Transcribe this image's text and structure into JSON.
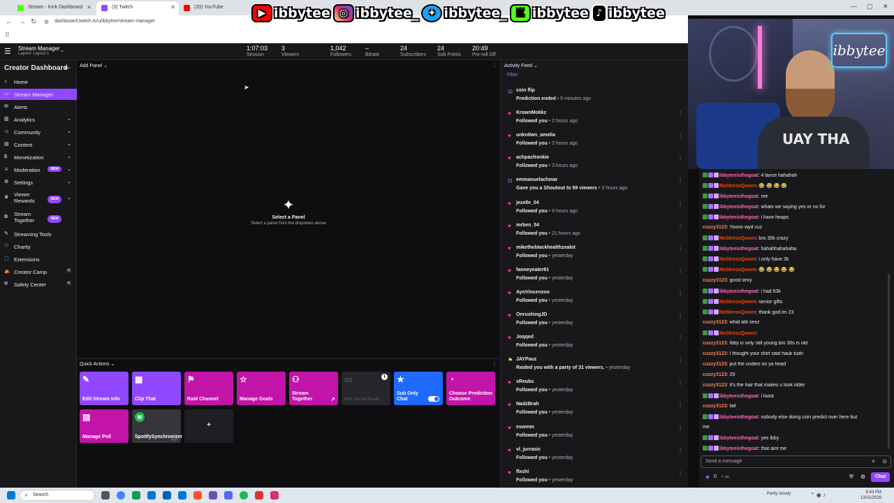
{
  "browser": {
    "tabs": [
      {
        "label": "Stream - Kick Dashboard",
        "color": "#53fc18"
      },
      {
        "label": "(3) Twitch",
        "color": "#9147ff"
      },
      {
        "label": "(20) YouTube",
        "color": "#ff0000"
      }
    ],
    "url": "dashboard.twitch.tv/u/ibbytee/stream-manager",
    "social": [
      {
        "icon": "youtube-icon",
        "color": "#ff0000",
        "handle": "ibbytee"
      },
      {
        "icon": "instagram-icon",
        "color": "#d62976",
        "handle": "ibbytee_"
      },
      {
        "icon": "twitter-icon",
        "color": "#1da1f2",
        "handle": "ibbytee_"
      },
      {
        "icon": "kick-icon",
        "color": "#53fc18",
        "handle": "ibbytee"
      },
      {
        "icon": "tiktok-icon",
        "color": "#000000",
        "handle": "ibbytee"
      }
    ]
  },
  "header": {
    "title": "Stream Manager",
    "layout": "Layout: Layout 1",
    "stats": [
      {
        "value": "1:07:03",
        "label": "Session"
      },
      {
        "value": "3",
        "label": "Viewers"
      },
      {
        "value": "1,042",
        "label": "Followers"
      },
      {
        "value": "–",
        "label": "Bitrate"
      },
      {
        "value": "24",
        "label": "Subscribers"
      },
      {
        "value": "24",
        "label": "Sub Points"
      },
      {
        "value": "20:49",
        "label": "Pre-roll Off"
      }
    ]
  },
  "sidebar": {
    "title": "Creator Dashboard",
    "items": [
      {
        "label": "Home"
      },
      {
        "label": "Stream Manager"
      },
      {
        "label": "Alerts"
      },
      {
        "label": "Analytics"
      },
      {
        "label": "Community"
      },
      {
        "label": "Content"
      },
      {
        "label": "Monetization"
      },
      {
        "label": "Moderation",
        "badge": "NEW"
      },
      {
        "label": "Settings"
      },
      {
        "label": "Viewer Rewards",
        "badge": "NEW"
      },
      {
        "label": "Stream Together",
        "badge": "NEW"
      },
      {
        "label": "Streaming Tools"
      },
      {
        "label": "Charity"
      },
      {
        "label": "Extensions"
      },
      {
        "label": "Creator Camp"
      },
      {
        "label": "Safety Center"
      }
    ]
  },
  "main": {
    "add_panel": "Add Panel",
    "select_title": "Select a Panel",
    "select_sub": "Select a panel from the dropdown above",
    "quick_actions_title": "Quick Actions",
    "quick_actions": [
      {
        "label": "Edit Stream Info",
        "color": "#9147ff"
      },
      {
        "label": "Clip That",
        "color": "#9147ff"
      },
      {
        "label": "Raid Channel",
        "color": "#c214a8"
      },
      {
        "label": "Manage Goals",
        "color": "#c214a8"
      },
      {
        "label": "Stream Together",
        "color": "#c214a8"
      },
      {
        "label": "Run 1m Ad Break",
        "color": "#26262c"
      },
      {
        "label": "Sub Only Chat",
        "color": "#1f69ff"
      },
      {
        "label": "Choose Prediction Outcome",
        "color": "#c214a8"
      },
      {
        "label": "Manage Poll",
        "color": "#c214a8"
      },
      {
        "label": "SpotifySynchronizer",
        "color": "#35353b"
      }
    ],
    "add_plus": "+"
  },
  "feed": {
    "title": "Activity Feed",
    "filter": "Filter",
    "entries": [
      {
        "name": "coin flip",
        "action": "Prediction ended",
        "time": "5 minutes ago",
        "icon": "prediction-icon"
      },
      {
        "name": "KrownMokkz",
        "action": "Followed you",
        "time": "2 hours ago",
        "icon": "heart-icon"
      },
      {
        "name": "unkn0wn_amelia",
        "action": "Followed you",
        "time": "2 hours ago",
        "icon": "heart-icon"
      },
      {
        "name": "achpacfrankie",
        "action": "Followed you",
        "time": "3 hours ago",
        "icon": "heart-icon"
      },
      {
        "name": "emmanuelachmar",
        "action": "Gave you a Shoutout to 59 viewers",
        "time": "3 hours ago",
        "icon": "shoutout-icon"
      },
      {
        "name": "jezelle_04",
        "action": "Followed you",
        "time": "6 hours ago",
        "icon": "heart-icon"
      },
      {
        "name": "mrben_54",
        "action": "Followed you",
        "time": "21 hours ago",
        "icon": "heart-icon"
      },
      {
        "name": "mikethebIackhealthzealot",
        "action": "Followed you",
        "time": "yesterday",
        "icon": "heart-icon"
      },
      {
        "name": "fanneyeater81",
        "action": "Followed you",
        "time": "yesterday",
        "icon": "heart-icon"
      },
      {
        "name": "AyoVincenzoo",
        "action": "Followed you",
        "time": "yesterday",
        "icon": "heart-icon"
      },
      {
        "name": "OnrushingJD",
        "action": "Followed you",
        "time": "yesterday",
        "icon": "heart-icon"
      },
      {
        "name": "Joqqed",
        "action": "Followed you",
        "time": "yesterday",
        "icon": "heart-icon"
      },
      {
        "name": "JAYPauz",
        "action": "Raided you with a party of 31 viewers.",
        "time": "yesterday",
        "icon": "raid-icon"
      },
      {
        "name": "xReubs",
        "action": "Followed you",
        "time": "yesterday",
        "icon": "heart-icon"
      },
      {
        "name": "NadzBrah",
        "action": "Followed you",
        "time": "yesterday",
        "icon": "heart-icon"
      },
      {
        "name": "eswmm",
        "action": "Followed you",
        "time": "yesterday",
        "icon": "heart-icon"
      },
      {
        "name": "vl_jurrasic",
        "action": "Followed you",
        "time": "yesterday",
        "icon": "heart-icon"
      },
      {
        "name": "flxshi",
        "action": "Followed you",
        "time": "yesterday",
        "icon": "heart-icon"
      }
    ]
  },
  "cam": {
    "overlay": "ibbytee"
  },
  "chat": {
    "messages": [
      {
        "user": "ibbyteeisthegoat",
        "color": "#ff69b4",
        "text": ": 4 lance hahahah"
      },
      {
        "user": "NoStressQueen",
        "color": "#ff4500",
        "text": ": 😂 😂 😂 😂"
      },
      {
        "user": "ibbyteeisthegoat",
        "color": "#ff69b4",
        "text": ": me"
      },
      {
        "user": "ibbyteeisthegoat",
        "color": "#ff69b4",
        "text": ": whats we saying yes or no for"
      },
      {
        "user": "ibbyteeisthegoat",
        "color": "#ff69b4",
        "text": ": i have heaps"
      },
      {
        "user": "cuzzy3123",
        "color": "#ff7f50",
        "text": ": Yoooo wyd cuz"
      },
      {
        "user": "NoStressQueen",
        "color": "#ff4500",
        "text": ": bro 35k crazy"
      },
      {
        "user": "ibbyteeisthegoat",
        "color": "#ff69b4",
        "text": ": hahahhahahaha"
      },
      {
        "user": "NoStressQueen",
        "color": "#ff4500",
        "text": ": i only have 2k"
      },
      {
        "user": "NoStressQueen",
        "color": "#ff4500",
        "text": ": 😂 😂 😂 😂 😂"
      },
      {
        "user": "cuzzy3123",
        "color": "#ff7f50",
        "text": ": good sexy"
      },
      {
        "user": "ibbyteeisthegoat",
        "color": "#ff69b4",
        "text": ": i had 63k"
      },
      {
        "user": "NoStressQueen",
        "color": "#ff4500",
        "text": ": senior gifts"
      },
      {
        "user": "NoStressQueen",
        "color": "#ff4500",
        "text": ": thank god im 23"
      },
      {
        "user": "cuzzy3123",
        "color": "#ff7f50",
        "text": ": what abt sexz"
      },
      {
        "user": "NoStressQueen",
        "color": "#ff4500",
        "text": ":"
      },
      {
        "user": "cuzzy3123",
        "color": "#ff7f50",
        "text": ": Ibby is only still young bro 30s is old"
      },
      {
        "user": "cuzzy3123",
        "color": "#ff7f50",
        "text": ": I thought your shirt said hauk tuah"
      },
      {
        "user": "cuzzy3123",
        "color": "#ff7f50",
        "text": ": put the undies on ya head"
      },
      {
        "user": "cuzzy3123",
        "color": "#ff7f50",
        "text": ": 29"
      },
      {
        "user": "cuzzy3123",
        "color": "#ff7f50",
        "text": ": it's the hair that makes u look older"
      },
      {
        "user": "ibbyteeisthegoat",
        "color": "#ff69b4",
        "text": ": i loost"
      },
      {
        "user": "cuzzy3123",
        "color": "#ff7f50",
        "text": ": tall"
      },
      {
        "user": "ibbyteeisthegoat",
        "color": "#ff69b4",
        "text": ": nobody else doing coin predict over here but"
      },
      {
        "user": "",
        "color": "#ff69b4",
        "text": "me"
      },
      {
        "user": "ibbyteeisthegoat",
        "color": "#ff69b4",
        "text": ": yes ibby"
      },
      {
        "user": "ibbyteeisthegoat",
        "color": "#ff69b4",
        "text": ": that aint me"
      }
    ],
    "placeholder": "Send a message",
    "points": "0",
    "send_label": "Chat"
  },
  "taskbar": {
    "search": "Search",
    "weather": "Partly cloudy",
    "time": "8:43 PM",
    "date": "13/01/2026"
  }
}
